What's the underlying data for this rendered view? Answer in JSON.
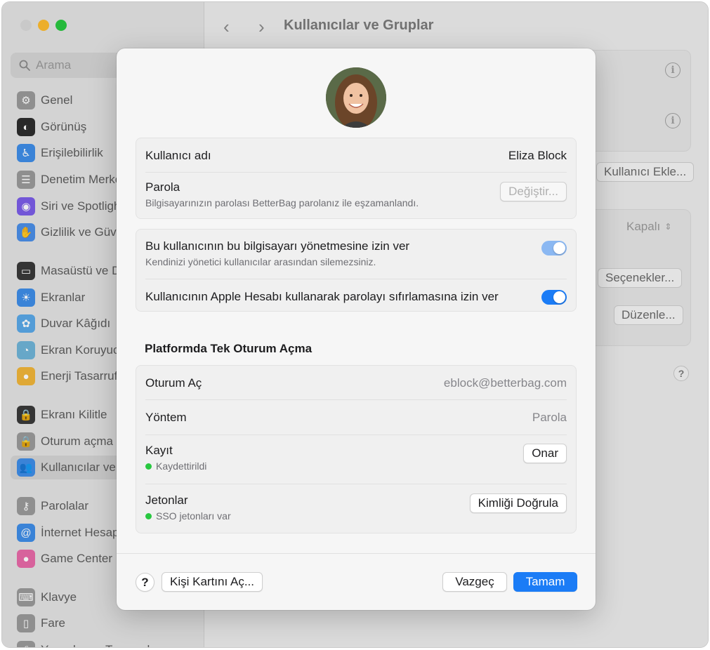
{
  "window": {
    "title": "Kullanıcılar ve Gruplar",
    "traffic_colors": [
      "#d9d9d9",
      "#febc2e",
      "#28c840"
    ]
  },
  "search": {
    "placeholder": "Arama"
  },
  "sidebar": {
    "items": [
      {
        "label": "Genel",
        "icon": "gear-icon",
        "color": "#9a9a9a",
        "glyph": "⚙"
      },
      {
        "label": "Görünüş",
        "icon": "appearance-icon",
        "color": "#2d2d2d",
        "glyph": "◐"
      },
      {
        "label": "Erişilebilirlik",
        "icon": "accessibility-icon",
        "color": "#3f8de8",
        "glyph": "♿"
      },
      {
        "label": "Denetim Merkezi",
        "icon": "control-center-icon",
        "color": "#9a9a9a",
        "glyph": "☰"
      },
      {
        "label": "Siri ve Spotlight",
        "icon": "siri-icon",
        "color": "#7b5de8",
        "glyph": "◉"
      },
      {
        "label": "Gizlilik ve Güvenlik",
        "icon": "privacy-hand-icon",
        "color": "#4b8ee8",
        "glyph": "✋"
      },
      {
        "label": "Masaüstü ve Dock",
        "icon": "desktop-dock-icon",
        "color": "#3a3a3a",
        "glyph": "▭"
      },
      {
        "label": "Ekranlar",
        "icon": "displays-icon",
        "color": "#3f8de8",
        "glyph": "☀"
      },
      {
        "label": "Duvar Kâğıdı",
        "icon": "wallpaper-icon",
        "color": "#5aa8e8",
        "glyph": "✿"
      },
      {
        "label": "Ekran Koruyucu",
        "icon": "screensaver-icon",
        "color": "#6fb4d8",
        "glyph": "◔"
      },
      {
        "label": "Enerji Tasarrufu",
        "icon": "energy-bulb-icon",
        "color": "#f0b53a",
        "glyph": "●"
      },
      {
        "label": "Ekranı Kilitle",
        "icon": "lock-screen-icon",
        "color": "#3a3a3a",
        "glyph": "🔒"
      },
      {
        "label": "Oturum açma",
        "icon": "login-lock-icon",
        "color": "#9a9a9a",
        "glyph": "🔒"
      },
      {
        "label": "Kullanıcılar ve Gruplar",
        "icon": "users-icon",
        "color": "#3f8de8",
        "glyph": "👥"
      },
      {
        "label": "Parolalar",
        "icon": "key-icon",
        "color": "#9a9a9a",
        "glyph": "⚷"
      },
      {
        "label": "İnternet Hesapları",
        "icon": "at-icon",
        "color": "#3f8de8",
        "glyph": "@"
      },
      {
        "label": "Game Center",
        "icon": "game-center-icon",
        "color": "#e86aa8",
        "glyph": "●"
      },
      {
        "label": "Klavye",
        "icon": "keyboard-icon",
        "color": "#9a9a9a",
        "glyph": "⌨"
      },
      {
        "label": "Fare",
        "icon": "mouse-icon",
        "color": "#9a9a9a",
        "glyph": "▯"
      },
      {
        "label": "Yazıcılar ve Tarayıcılar",
        "icon": "printer-icon",
        "color": "#9a9a9a",
        "glyph": "⎙"
      }
    ]
  },
  "background_main": {
    "add_user_button": "Kullanıcı Ekle...",
    "off_select": "Kapalı",
    "options_button": "Seçenekler...",
    "edit_button": "Düzenle..."
  },
  "sheet": {
    "username_label": "Kullanıcı adı",
    "username_value": "Eliza Block",
    "password_label": "Parola",
    "password_sub": "Bilgisayarınızın parolası BetterBag parolanız ile eşzamanlandı.",
    "change_button": "Değiştir...",
    "admin_label": "Bu kullanıcının bu bilgisayarı yönetmesine izin ver",
    "admin_sub": "Kendinizi yönetici kullanıcılar arasından silemezsiniz.",
    "admin_toggle_color": "#8bb8f2",
    "reset_label": "Kullanıcının Apple Hesabı kullanarak parolayı sıfırlamasına izin ver",
    "reset_toggle_color": "#1b7cf6",
    "sso_section_title": "Platformda Tek Oturum Açma",
    "signin_label": "Oturum Aç",
    "signin_value": "eblock@betterbag.com",
    "method_label": "Yöntem",
    "method_value": "Parola",
    "registration_label": "Kayıt",
    "registration_status": "Kaydettirildi",
    "repair_button": "Onar",
    "tokens_label": "Jetonlar",
    "tokens_status": "SSO jetonları var",
    "authenticate_button": "Kimliği Doğrula",
    "status_color": "#28c840",
    "help_label": "?",
    "open_card_button": "Kişi Kartını Aç...",
    "cancel_button": "Vazgeç",
    "ok_button": "Tamam"
  }
}
